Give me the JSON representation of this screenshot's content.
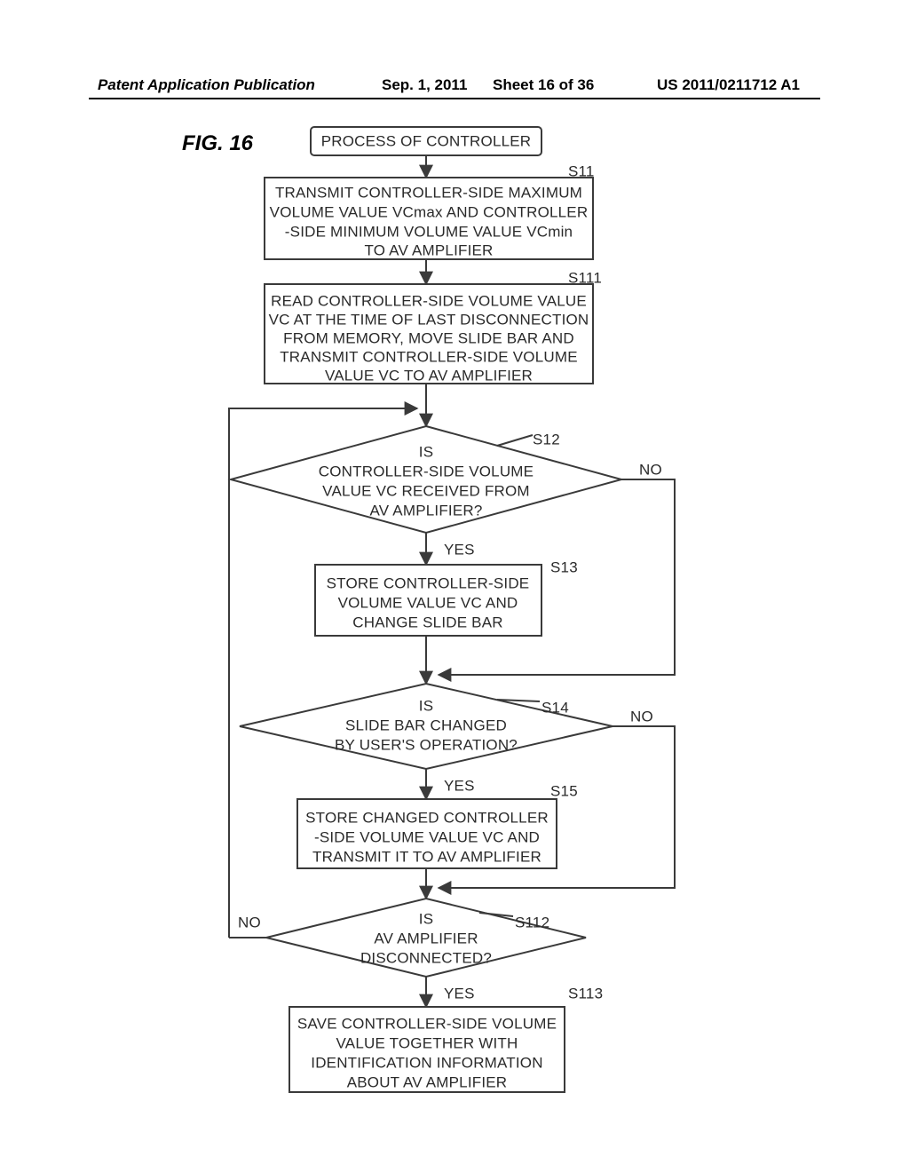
{
  "header": {
    "left": "Patent Application Publication",
    "date": "Sep. 1, 2011",
    "sheet": "Sheet 16 of 36",
    "pubno": "US 2011/0211712 A1"
  },
  "figure_label": "FIG.  16",
  "start": "PROCESS OF CONTROLLER",
  "s11_lbl": "S11",
  "s11": [
    "TRANSMIT CONTROLLER-SIDE MAXIMUM",
    "VOLUME VALUE VCmax AND CONTROLLER",
    "-SIDE MINIMUM VOLUME VALUE VCmin",
    "TO AV AMPLIFIER"
  ],
  "s111_lbl": "S111",
  "s111": [
    "READ CONTROLLER-SIDE VOLUME VALUE",
    "VC AT THE TIME OF LAST DISCONNECTION",
    "FROM MEMORY, MOVE SLIDE BAR AND",
    "TRANSMIT CONTROLLER-SIDE VOLUME",
    "VALUE VC TO AV AMPLIFIER"
  ],
  "s12_lbl": "S12",
  "s12": [
    "IS",
    "CONTROLLER-SIDE VOLUME",
    "VALUE VC RECEIVED FROM",
    "AV AMPLIFIER?"
  ],
  "s13_lbl": "S13",
  "s13": [
    "STORE CONTROLLER-SIDE",
    "VOLUME VALUE VC AND",
    "CHANGE SLIDE BAR"
  ],
  "s14_lbl": "S14",
  "s14": [
    "IS",
    "SLIDE BAR CHANGED",
    "BY USER'S OPERATION?"
  ],
  "s15_lbl": "S15",
  "s15": [
    "STORE CHANGED CONTROLLER",
    "-SIDE VOLUME VALUE VC AND",
    "TRANSMIT IT TO AV AMPLIFIER"
  ],
  "s112_lbl": "S112",
  "s112": [
    "IS",
    "AV AMPLIFIER",
    "DISCONNECTED?"
  ],
  "s113_lbl": "S113",
  "s113": [
    "SAVE CONTROLLER-SIDE VOLUME",
    "VALUE TOGETHER WITH",
    "IDENTIFICATION INFORMATION",
    "ABOUT AV AMPLIFIER"
  ],
  "yes": "YES",
  "no": "NO"
}
